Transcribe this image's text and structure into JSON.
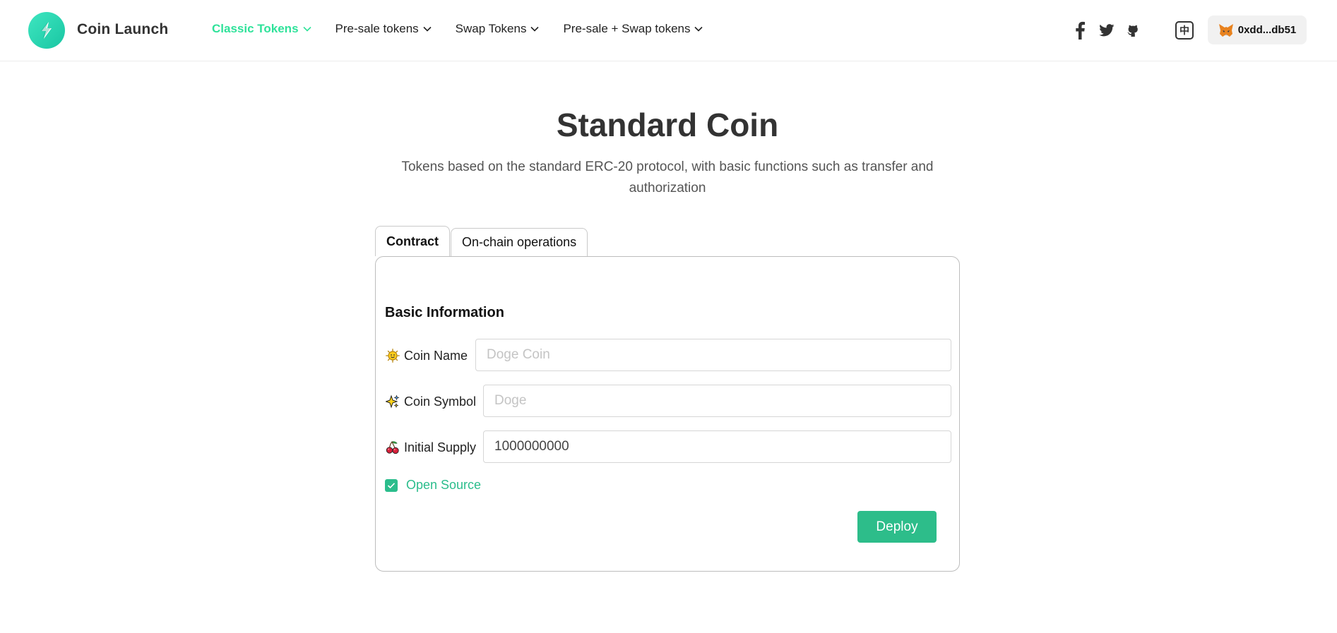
{
  "app": {
    "brand": "Coin Launch"
  },
  "nav": {
    "items": [
      {
        "label": "Classic Tokens",
        "active": true
      },
      {
        "label": "Pre-sale tokens",
        "active": false
      },
      {
        "label": "Swap Tokens",
        "active": false
      },
      {
        "label": "Pre-sale + Swap tokens",
        "active": false
      }
    ]
  },
  "header": {
    "socials": [
      "facebook-icon",
      "twitter-icon",
      "github-icon"
    ],
    "language_label": "中",
    "wallet_address": "0xdd...db51"
  },
  "main": {
    "title": "Standard Coin",
    "subtitle": "Tokens based on the standard ERC-20 protocol, with basic functions such as transfer and authorization",
    "tabs": [
      {
        "label": "Contract",
        "active": true
      },
      {
        "label": "On-chain operations",
        "active": false
      }
    ],
    "form": {
      "section_title": "Basic Information",
      "coin_name": {
        "label": "Coin Name",
        "placeholder": "Doge Coin",
        "value": "",
        "icon": "sun-emoji-icon"
      },
      "coin_symbol": {
        "label": "Coin Symbol",
        "placeholder": "Doge",
        "value": "",
        "icon": "sparkle-emoji-icon"
      },
      "initial_supply": {
        "label": "Initial Supply",
        "placeholder": "",
        "value": "1000000000",
        "icon": "cherries-emoji-icon"
      },
      "open_source": {
        "label": "Open Source",
        "checked": true
      },
      "deploy_label": "Deploy"
    }
  },
  "colors": {
    "accent": "#2fe29a",
    "primary_button": "#2dbd8a",
    "logo": "#19c6a3"
  }
}
